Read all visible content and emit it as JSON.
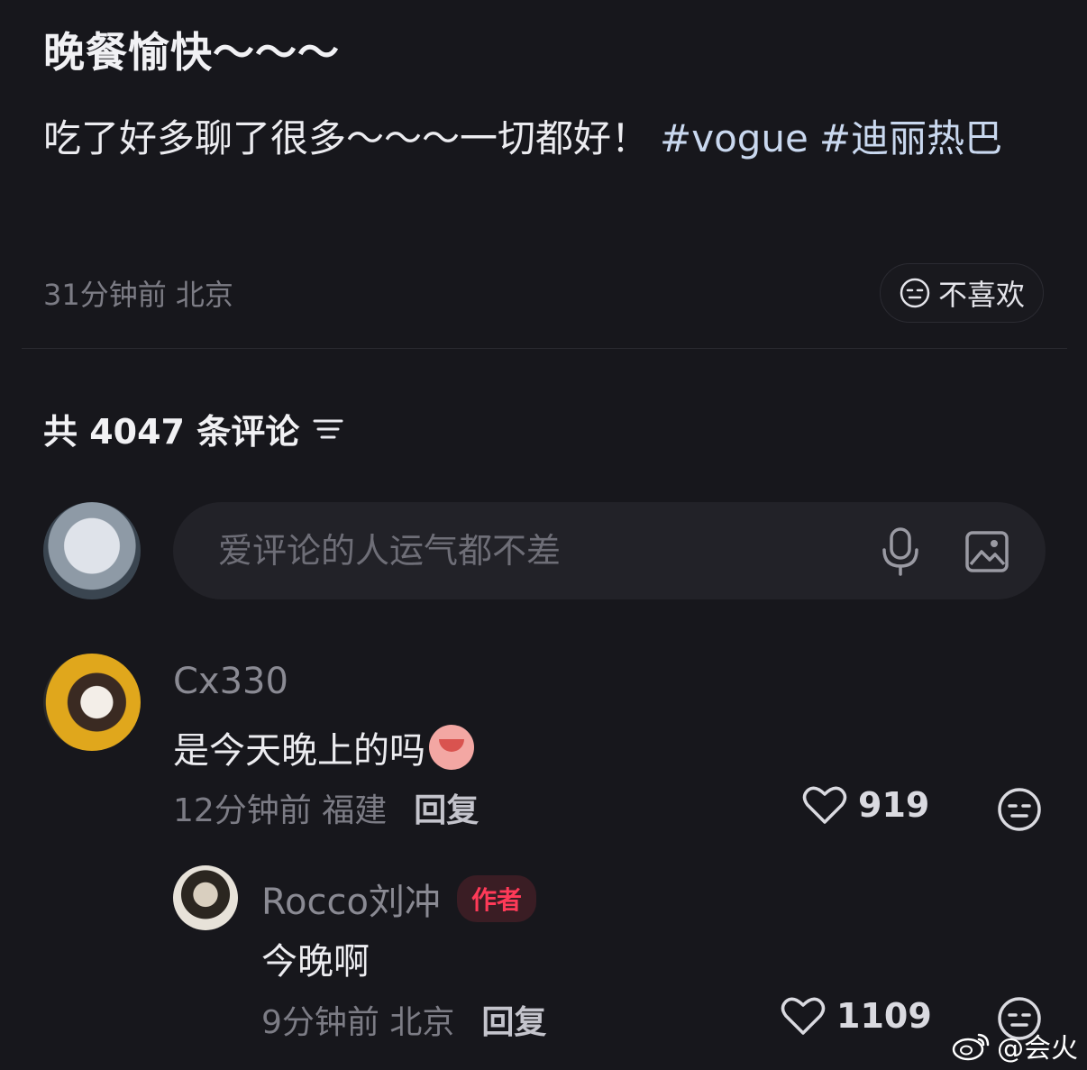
{
  "post": {
    "title": "晚餐愉快～～～",
    "body_text": "吃了好多聊了很多～～～一切都好！",
    "tags": [
      "#vogue",
      "#迪丽热巴"
    ],
    "meta": "31分钟前 北京",
    "dislike_label": "不喜欢"
  },
  "comments_header": {
    "label": "共 4047 条评论"
  },
  "comment_input": {
    "placeholder": "爱评论的人运气都不差"
  },
  "comments": [
    {
      "username": "Cx330",
      "text": "是今天晚上的吗",
      "meta": "12分钟前 福建",
      "reply_label": "回复",
      "likes": "919"
    },
    {
      "username": "Rocco刘冲",
      "badge": "作者",
      "text": "今晚啊",
      "meta": "9分钟前 北京",
      "reply_label": "回复",
      "likes": "1109"
    }
  ],
  "watermark": {
    "text": "@会火"
  },
  "colors": {
    "background": "#17171c",
    "tag": "#c9d8ef",
    "author_badge": "#ff3a58"
  },
  "icons": [
    "dislike-face-icon",
    "sort-icon",
    "mic-icon",
    "image-icon",
    "heart-icon",
    "weibo-logo-icon"
  ]
}
